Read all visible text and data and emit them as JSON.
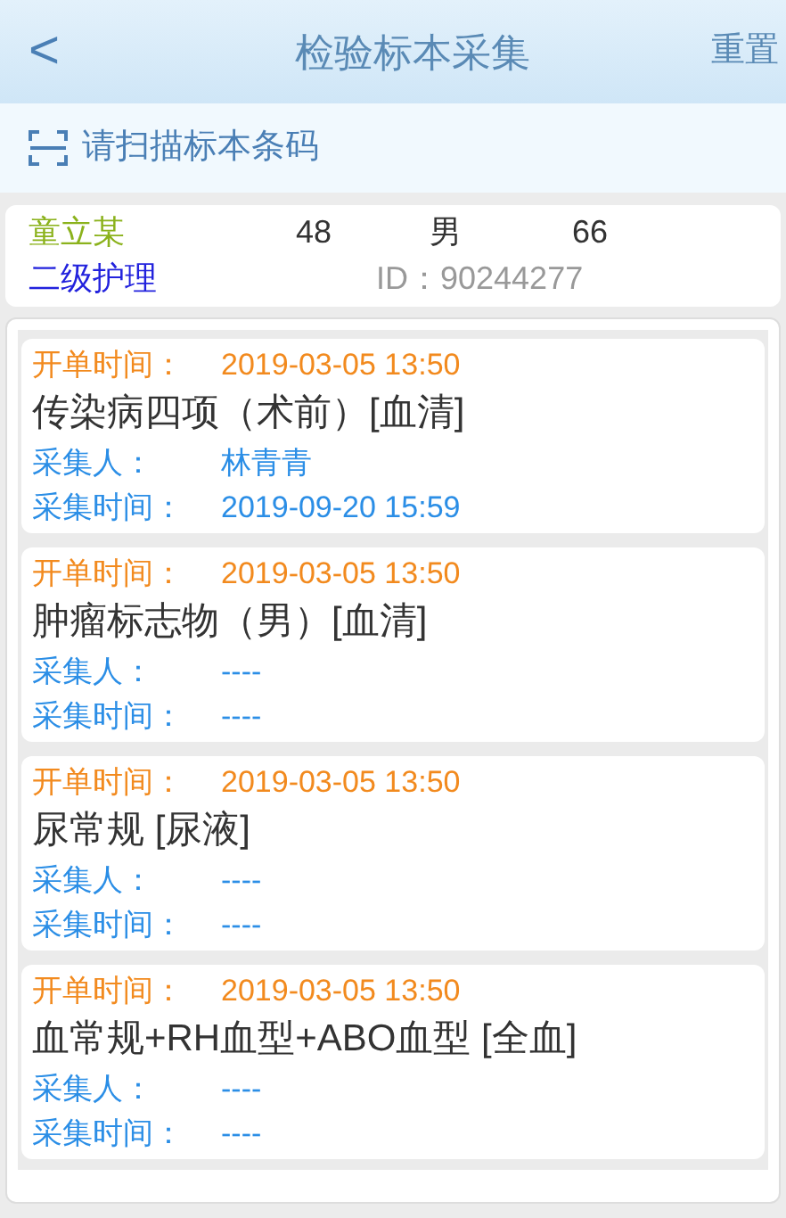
{
  "header": {
    "back": "<",
    "title": "检验标本采集",
    "action": "重置"
  },
  "scan": {
    "placeholder": "请扫描标本条码"
  },
  "patient": {
    "name": "童立某",
    "age": "48",
    "sex": "男",
    "bed": "66",
    "care_level": "二级护理",
    "id": "ID：90244277"
  },
  "orders": [
    {
      "order_time_label": "开单时间：",
      "order_time": "2019-03-05 13:50",
      "test": "传染病四项（术前）[血清]",
      "collector_label": "采集人：",
      "collector": "林青青",
      "collect_time_label": "采集时间：",
      "collect_time": "2019-09-20 15:59"
    },
    {
      "order_time_label": "开单时间：",
      "order_time": "2019-03-05 13:50",
      "test": "肿瘤标志物（男）[血清]",
      "collector_label": "采集人：",
      "collector": "----",
      "collect_time_label": "采集时间：",
      "collect_time": "----"
    },
    {
      "order_time_label": "开单时间：",
      "order_time": "2019-03-05 13:50",
      "test": "尿常规 [尿液]",
      "collector_label": "采集人：",
      "collector": "----",
      "collect_time_label": "采集时间：",
      "collect_time": "----"
    },
    {
      "order_time_label": "开单时间：",
      "order_time": "2019-03-05 13:50",
      "test": "血常规+RH血型+ABO血型 [全血]",
      "collector_label": "采集人：",
      "collector": "----",
      "collect_time_label": "采集时间：",
      "collect_time": "----"
    }
  ]
}
